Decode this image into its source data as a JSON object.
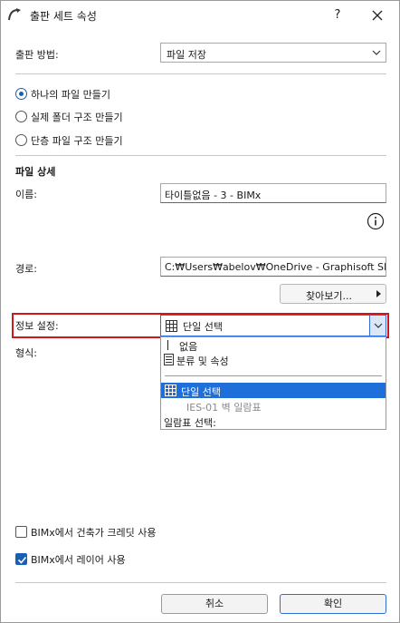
{
  "window": {
    "title": "출판 세트 속성",
    "help_label": "?"
  },
  "publish": {
    "label": "출판 방법:",
    "selected": "파일 저장"
  },
  "options": [
    {
      "label": "하나의 파일 만들기",
      "selected": true
    },
    {
      "label": "실제 폴더 구조 만들기",
      "selected": false
    },
    {
      "label": "단층 파일 구조 만들기",
      "selected": false
    }
  ],
  "file_details": {
    "section_title": "파일 상세",
    "name_label": "이름:",
    "name_value": "타이틀없음 - 3 - BIMx",
    "path_label": "경로:",
    "path_value": "C:₩Users₩abelov₩OneDrive - Graphisoft SE₩LC",
    "browse_label": "찾아보기..."
  },
  "info_settings": {
    "label": "정보 설정:",
    "selected": "단일 선택",
    "format_label": "형식:",
    "dropdown": {
      "none": "없음",
      "classify": "분류 및 속성",
      "single": "단일 선택",
      "sub_item": "IES-01 벽 일람표",
      "schedule": "일람표 선택:"
    }
  },
  "checkboxes": [
    {
      "label": "BIMx에서 건축가 크레딧 사용",
      "checked": false
    },
    {
      "label": "BIMx에서 레이어 사용",
      "checked": true
    }
  ],
  "buttons": {
    "cancel": "취소",
    "ok": "확인"
  },
  "colors": {
    "accent": "#1e6fd9",
    "highlight_border": "#d0161d"
  }
}
